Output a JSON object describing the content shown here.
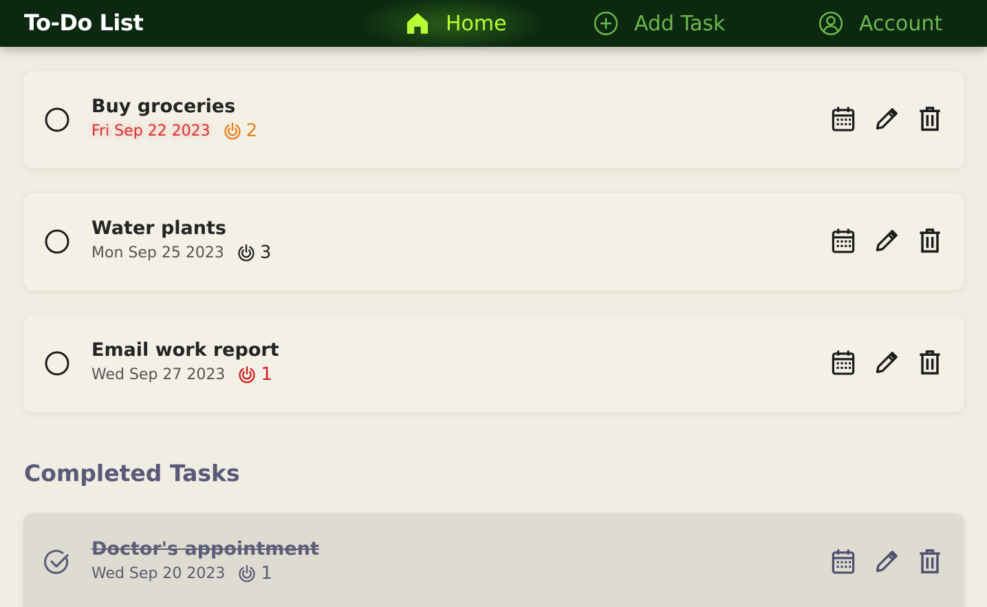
{
  "app": {
    "title": "To-Do List"
  },
  "nav": {
    "home": "Home",
    "add_task": "Add Task",
    "account": "Account"
  },
  "tasks": [
    {
      "title": "Buy groceries",
      "date": "Fri Sep 22 2023",
      "priority": "2",
      "overdue": true,
      "priority_color": "#e8811c"
    },
    {
      "title": "Water plants",
      "date": "Mon Sep 25 2023",
      "priority": "3",
      "overdue": false,
      "priority_color": "#222222"
    },
    {
      "title": "Email work report",
      "date": "Wed Sep 27 2023",
      "priority": "1",
      "overdue": false,
      "priority_color": "#d01f1f"
    }
  ],
  "completed_section": {
    "title": "Completed Tasks"
  },
  "completed": [
    {
      "title": "Doctor's appointment",
      "date": "Wed Sep 20 2023",
      "priority": "1",
      "priority_color": "#5a5c78"
    }
  ],
  "icons": {
    "nav": [
      "home-icon",
      "add-circle-icon",
      "account-circle-icon"
    ],
    "task_actions": [
      "calendar-icon",
      "pencil-icon",
      "trash-icon"
    ],
    "priority": "priority-target-icon"
  },
  "colors": {
    "header_bg": "#0c2811",
    "nav_active": "#b7ff33",
    "nav_inactive": "#6cb84c",
    "page_bg": "#f0ede2",
    "overdue": "#d83030"
  }
}
